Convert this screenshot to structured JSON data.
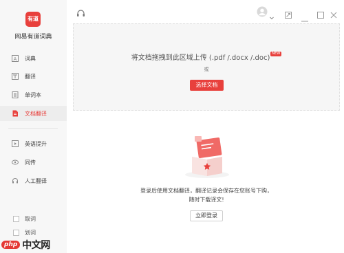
{
  "app": {
    "logo_text": "有道",
    "name": "网易有道词典"
  },
  "sidebar": {
    "items": [
      {
        "label": "词典"
      },
      {
        "label": "翻译"
      },
      {
        "label": "单词本"
      },
      {
        "label": "文档翻译"
      },
      {
        "label": "英语提升"
      },
      {
        "label": "同传"
      },
      {
        "label": "人工翻译"
      }
    ],
    "active_index": 3,
    "footer": [
      {
        "label": "取词"
      },
      {
        "label": "划词"
      }
    ]
  },
  "watermark": {
    "php": "php",
    "cn": "中文网"
  },
  "upload": {
    "title": "将文档拖拽到此区域上传 (.pdf /.docx /.doc)",
    "new_badge": "NEW",
    "or": "或",
    "choose_button": "选择文档"
  },
  "message": {
    "line1": "登录后使用文档翻译，翻译记录会保存在您账号下购，",
    "line2": "随时下载译文!",
    "login_button": "立即登录"
  },
  "colors": {
    "accent": "#e8403c",
    "sidebar_bg": "#f7f7f7"
  }
}
